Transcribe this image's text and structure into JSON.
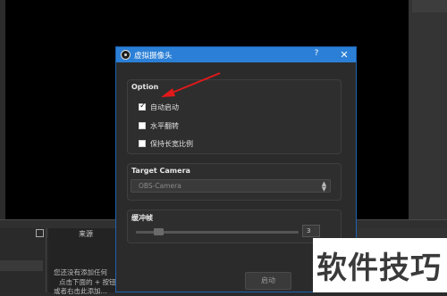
{
  "dialog": {
    "title": "虚拟摄像头",
    "help_label": "?",
    "close_label": "✕",
    "option_group": {
      "title": "Option",
      "checkboxes": [
        {
          "label": "自动启动",
          "checked": true
        },
        {
          "label": "水平翻转",
          "checked": false
        },
        {
          "label": "保持长宽比例",
          "checked": false
        }
      ]
    },
    "target_group": {
      "title": "Target Camera",
      "combo_value": "OBS-Camera"
    },
    "buffer_group": {
      "title": "缓冲帧",
      "spin_value": "3"
    },
    "start_label": "启动"
  },
  "background": {
    "sources_title": "来源",
    "hint_lines": [
      "您还没有添加任何",
      "点击下面的 + 按钮",
      "或者右击此添加..."
    ]
  },
  "watermark": {
    "text": "软件技巧"
  },
  "colors": {
    "titlebar": "#2b7fd6",
    "annotation_arrow": "#e0191b"
  }
}
